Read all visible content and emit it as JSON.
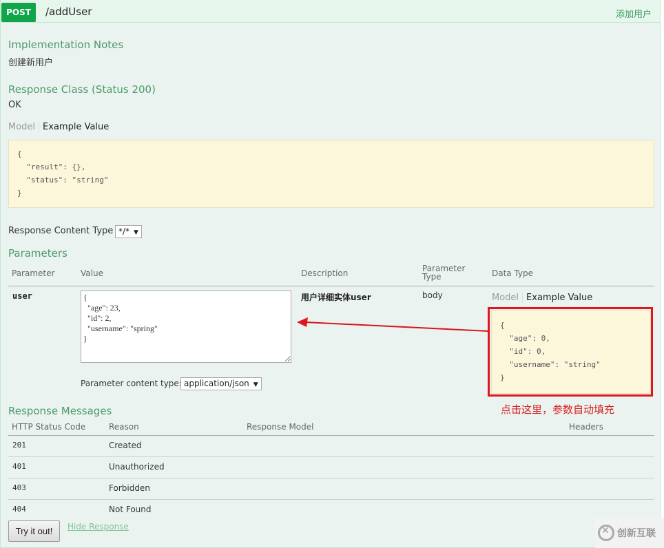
{
  "operation": {
    "method": "POST",
    "path": "/addUser",
    "summary": "添加用户",
    "method_color": "#10a54a"
  },
  "implementation_notes": {
    "heading": "Implementation Notes",
    "text": "创建新用户"
  },
  "response_class": {
    "heading": "Response Class (Status 200)",
    "text": "OK",
    "tabs": {
      "model": "Model",
      "example": "Example Value"
    },
    "example_json": "{\n  \"result\": {},\n  \"status\": \"string\"\n}"
  },
  "response_content_type": {
    "label": "Response Content Type",
    "selected": "*/*"
  },
  "parameters": {
    "heading": "Parameters",
    "columns": [
      "Parameter",
      "Value",
      "Description",
      "Parameter Type",
      "Data Type"
    ],
    "column_param_type_line1": "Parameter",
    "column_param_type_line2": "Type",
    "rows": [
      {
        "name": "user",
        "value": "{\n  \"age\": 23,\n  \"id\": 2,\n  \"username\": \"spring\"\n}",
        "description": "用户详细实体user",
        "param_type": "body",
        "data_type_tabs": {
          "model": "Model",
          "example": "Example Value"
        },
        "data_type_example": "{\n  \"age\": 0,\n  \"id\": 0,\n  \"username\": \"string\"\n}"
      }
    ],
    "content_type_label": "Parameter content type:",
    "content_type_selected": "application/json"
  },
  "annotation": {
    "text": "点击这里，参数自动填充",
    "color": "#e3141b"
  },
  "response_messages": {
    "heading": "Response Messages",
    "columns": [
      "HTTP Status Code",
      "Reason",
      "Response Model",
      "Headers"
    ],
    "rows": [
      {
        "code": "201",
        "reason": "Created"
      },
      {
        "code": "401",
        "reason": "Unauthorized"
      },
      {
        "code": "403",
        "reason": "Forbidden"
      },
      {
        "code": "404",
        "reason": "Not Found"
      }
    ]
  },
  "actions": {
    "try_button": "Try it out!",
    "hide_response": "Hide Response"
  },
  "watermark": {
    "text": "创新互联"
  }
}
